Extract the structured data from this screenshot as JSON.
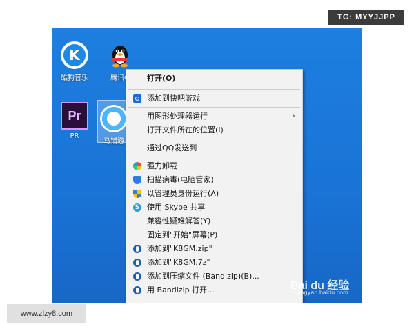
{
  "badges": {
    "top_right": "TG: MYYJJPP",
    "bottom_left": "www.zlzy8.com"
  },
  "desktop": {
    "icons": [
      {
        "label": "酷狗音乐",
        "glyph": "K"
      },
      {
        "label": "腾讯Q",
        "glyph": "qq-penguin-icon"
      },
      {
        "label": "PR",
        "glyph": "Pr"
      },
      {
        "label": "马铺游",
        "glyph": "mato-icon"
      }
    ]
  },
  "context_menu": {
    "items": [
      {
        "label": "打开(O)",
        "bold": true
      },
      {
        "label": "添加到快吧游戏",
        "icon": "search-icon"
      },
      {
        "label": "用图形处理器运行",
        "submenu": true
      },
      {
        "label": "打开文件所在的位置(I)"
      },
      {
        "label": "通过QQ发送到"
      },
      {
        "label": "强力卸载",
        "icon": "petal-icon"
      },
      {
        "label": "扫描病毒(电脑管家)",
        "icon": "shield-icon"
      },
      {
        "label": "以管理员身份运行(A)",
        "icon": "uac-shield-icon"
      },
      {
        "label": "使用 Skype 共享",
        "icon": "skype-icon"
      },
      {
        "label": "兼容性疑难解答(Y)"
      },
      {
        "label": "固定到\"开始\"屏幕(P)"
      },
      {
        "label": "添加到\"K8GM.zip\"",
        "icon": "bandizip-icon"
      },
      {
        "label": "添加到\"K8GM.7z\"",
        "icon": "bandizip-icon"
      },
      {
        "label": "添加到压缩文件 (Bandizip)(B)...",
        "icon": "bandizip-icon"
      },
      {
        "label": "用 Bandizip 打开...",
        "icon": "bandizip-icon"
      }
    ],
    "submenu_glyph": "›"
  },
  "watermark": {
    "brand": "Bai du 经验",
    "url": "jingyan.baidu.com"
  }
}
